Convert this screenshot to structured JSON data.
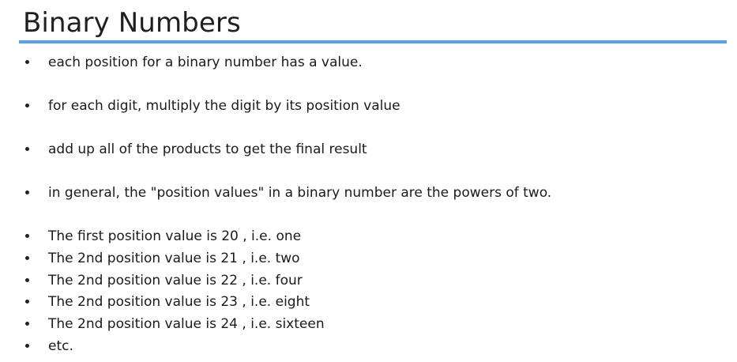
{
  "slide": {
    "title": "Binary Numbers",
    "accent_color": "#5aa0e6",
    "bullets": [
      "each position for a binary number has a value.",
      "for each digit, multiply the digit by its position value",
      "add up all of the products to get the final result",
      "in general, the \"position values\" in a binary number are the powers of two.",
      "The first position value is 20 , i.e. one",
      "The 2nd position value is 21 , i.e. two",
      "The 2nd position value is 22 , i.e. four",
      "The 2nd position value is 23 , i.e. eight",
      "The 2nd position value is 24 , i.e. sixteen",
      "etc."
    ]
  }
}
